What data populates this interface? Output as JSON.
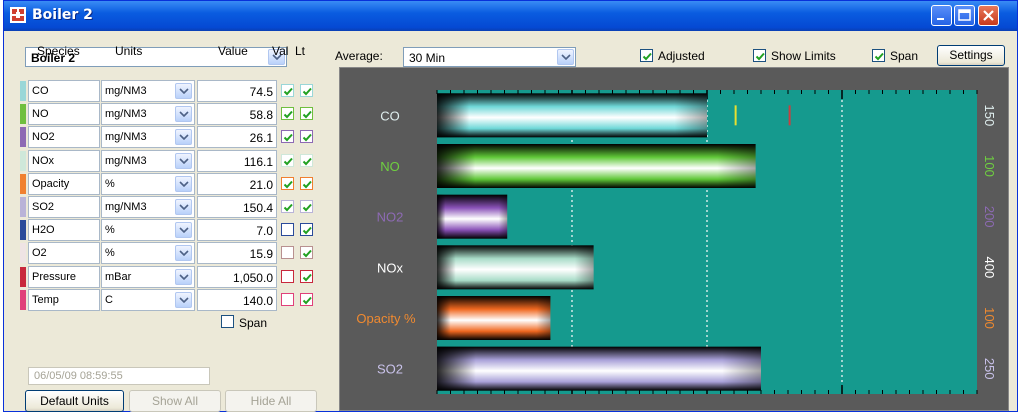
{
  "window": {
    "title": "Boiler 2"
  },
  "boiler_select": {
    "value": "Boiler 2"
  },
  "average": {
    "label": "Average:",
    "value": "30 Min"
  },
  "options": {
    "adjusted": "Adjusted",
    "show_limits": "Show Limits",
    "span": "Span",
    "settings": "Settings"
  },
  "columns": {
    "species": "Species",
    "units": "Units",
    "value": "Value",
    "val": "Val",
    "lt": "Lt"
  },
  "rows": [
    {
      "species": "CO",
      "units": "mg/NM3",
      "value": "74.5",
      "color": "#9ad7d8",
      "val_checked": true,
      "lt_checked": true
    },
    {
      "species": "NO",
      "units": "mg/NM3",
      "value": "58.8",
      "color": "#6fbf3f",
      "val_checked": true,
      "lt_checked": true
    },
    {
      "species": "NO2",
      "units": "mg/NM3",
      "value": "26.1",
      "color": "#8d6ab4",
      "val_checked": true,
      "lt_checked": true
    },
    {
      "species": "NOx",
      "units": "mg/NM3",
      "value": "116.1",
      "color": "#cfe8da",
      "val_checked": true,
      "lt_checked": true
    },
    {
      "species": "Opacity",
      "units": "%",
      "value": "21.0",
      "color": "#f08030",
      "val_checked": true,
      "lt_checked": true
    },
    {
      "species": "SO2",
      "units": "mg/NM3",
      "value": "150.4",
      "color": "#b9b3d8",
      "val_checked": true,
      "lt_checked": true
    },
    {
      "species": "H2O",
      "units": "%",
      "value": "7.0",
      "color": "#2a4a9a",
      "val_checked": false,
      "lt_checked": true
    },
    {
      "species": "O2",
      "units": "%",
      "value": "15.9",
      "color": "#efe4e4",
      "val_checked": false,
      "lt_checked": true
    },
    {
      "species": "Pressure",
      "units": "mBar",
      "value": "1,050.0",
      "color": "#c8283c",
      "val_checked": false,
      "lt_checked": true
    },
    {
      "species": "Temp",
      "units": "C",
      "value": "140.0",
      "color": "#e0407a",
      "val_checked": false,
      "lt_checked": true
    }
  ],
  "span_checkbox": "Span",
  "timestamp": "06/05/09 08:59:55",
  "buttons": {
    "default_units": "Default Units",
    "show_all": "Show All",
    "hide_all": "Hide All"
  },
  "colors": {
    "chart_bg": "#159a8e",
    "chart_frame": "#5a5a5a"
  },
  "chart_data": {
    "type": "bar",
    "orientation": "horizontal",
    "categories": [
      "CO",
      "NO",
      "NO2",
      "NOx",
      "Opacity %",
      "SO2"
    ],
    "category_colors": [
      "#dfeeee",
      "#6fd040",
      "#8d6ab4",
      "#ffffff",
      "#f08a30",
      "#c9c2ea"
    ],
    "fractions_of_full_scale": [
      0.5,
      0.59,
      0.13,
      0.29,
      0.21,
      0.6
    ],
    "full_scale": [
      "150",
      "100",
      "200",
      "400",
      "100",
      "250"
    ],
    "series": [
      {
        "colors": [
          "#6fd8d8",
          "#60c838",
          "#8a52b8",
          "#a8dcc8",
          "#f06820",
          "#a8a0d8"
        ]
      }
    ],
    "markers": [
      {
        "category": "CO",
        "value": 0.553,
        "color": "#e8e030"
      },
      {
        "category": "CO",
        "value": 0.653,
        "color": "#c84040"
      }
    ],
    "gridlines_fraction": [
      0.25,
      0.5,
      0.75
    ],
    "legend": "none",
    "grid": true
  }
}
